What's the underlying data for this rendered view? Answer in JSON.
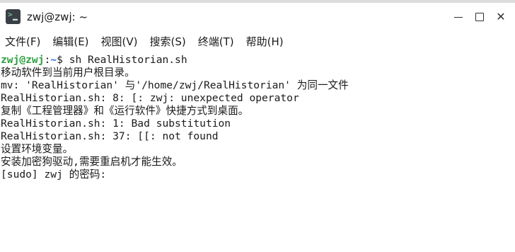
{
  "window": {
    "title": "zwj@zwj: ~"
  },
  "menu": {
    "items": [
      {
        "label": "文件(F)"
      },
      {
        "label": "编辑(E)"
      },
      {
        "label": "视图(V)"
      },
      {
        "label": "搜索(S)"
      },
      {
        "label": "终端(T)"
      },
      {
        "label": "帮助(H)"
      }
    ]
  },
  "terminal": {
    "prompt_user": "zwj@zwj",
    "prompt_sep": ":",
    "prompt_path": "~",
    "prompt_symbol": "$ ",
    "command": "sh RealHistorian.sh",
    "output": [
      "移动软件到当前用户根目录。",
      "mv: 'RealHistorian' 与'/home/zwj/RealHistorian' 为同一文件",
      "RealHistorian.sh: 8: [: zwj: unexpected operator",
      "复制《工程管理器》和《运行软件》快捷方式到桌面。",
      "RealHistorian.sh: 1: Bad substitution",
      "RealHistorian.sh: 37: [[: not found",
      "设置环境变量。",
      "安装加密狗驱动,需要重启机才能生效。",
      "[sudo] zwj 的密码:"
    ]
  },
  "colors": {
    "prompt_user": "#2ea043",
    "prompt_path": "#2b6cd8",
    "text": "#1a1a1a",
    "background": "#ffffff"
  }
}
